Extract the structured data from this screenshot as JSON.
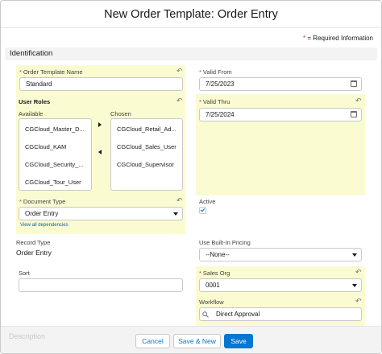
{
  "modal": {
    "title": "New Order Template: Order Entry"
  },
  "required_info": {
    "star": "*",
    "text": "= Required Information"
  },
  "section": {
    "title": "Identification"
  },
  "fields": {
    "order_template_name": {
      "label": "Order Template Name",
      "value": "Standard"
    },
    "valid_from": {
      "label": "Valid From",
      "value": "7/25/2023"
    },
    "valid_thru": {
      "label": "Valid Thru",
      "value": "7/25/2024"
    },
    "user_roles": {
      "label": "User Roles",
      "available_label": "Available",
      "chosen_label": "Chosen",
      "available": [
        "CGCloud_Master_D...",
        "CGCloud_KAM",
        "CGCloud_Security_...",
        "CGCloud_Tour_User"
      ],
      "chosen": [
        "CGCloud_Retail_Ad...",
        "CGCloud_Sales_User",
        "CGCloud_Supervisor"
      ]
    },
    "document_type": {
      "label": "Document Type",
      "value": "Order Entry",
      "link": "View all dependencies"
    },
    "active": {
      "label": "Active",
      "checked": true
    },
    "record_type": {
      "label": "Record Type",
      "value": "Order Entry"
    },
    "use_built_in_pricing": {
      "label": "Use Built-In Pricing",
      "value": "--None--"
    },
    "sort": {
      "label": "Sort",
      "value": ""
    },
    "sales_org": {
      "label": "Sales Org",
      "value": "0001"
    },
    "workflow": {
      "label": "Workflow",
      "value": "Direct Approval"
    },
    "description": {
      "label": "Description"
    }
  },
  "footer": {
    "cancel": "Cancel",
    "save_new": "Save & New",
    "save": "Save"
  },
  "colors": {
    "brand": "#0176d3",
    "highlight": "#fbfbd2",
    "required": "#c23934"
  }
}
